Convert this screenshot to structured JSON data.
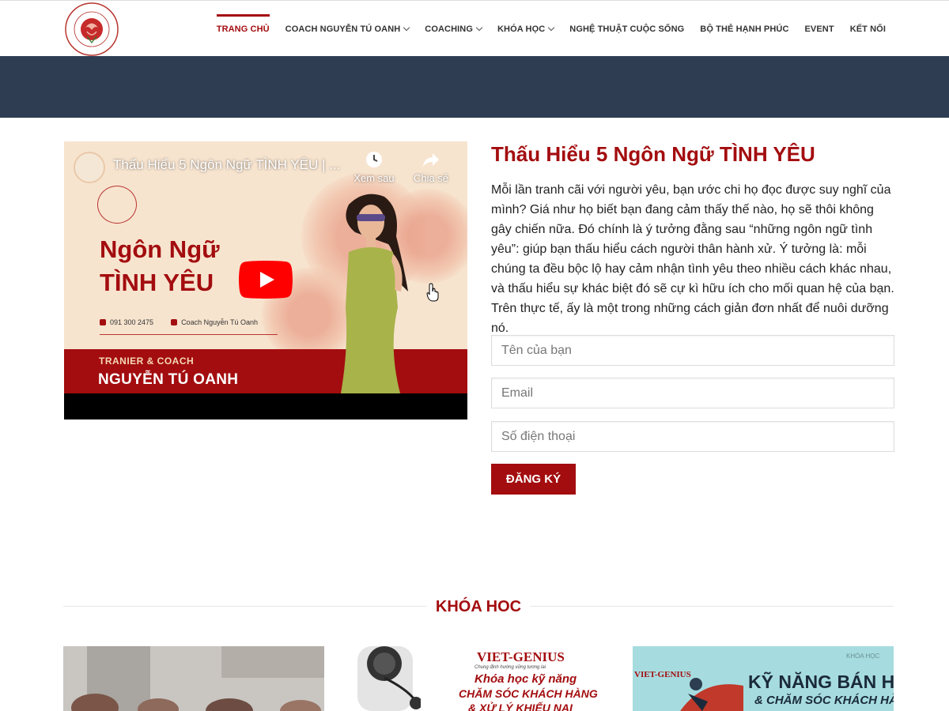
{
  "logo": {
    "alt": "COACH NGUYỄN TÚ OANH",
    "top_text": "COACH",
    "bottom_text": "NGUYỄN TÚ OANH"
  },
  "nav": {
    "items": [
      {
        "label": "TRANG CHỦ",
        "active": true,
        "has_dropdown": false
      },
      {
        "label": "COACH NGUYỄN TÚ OANH",
        "active": false,
        "has_dropdown": true
      },
      {
        "label": "COACHING",
        "active": false,
        "has_dropdown": true
      },
      {
        "label": "KHÓA HỌC",
        "active": false,
        "has_dropdown": true
      },
      {
        "label": "NGHỆ THUẬT CUỘC SỐNG",
        "active": false,
        "has_dropdown": false
      },
      {
        "label": "BỘ THẺ HẠNH PHÚC",
        "active": false,
        "has_dropdown": false
      },
      {
        "label": "EVENT",
        "active": false,
        "has_dropdown": false
      },
      {
        "label": "KẾT NỐI",
        "active": false,
        "has_dropdown": false
      }
    ]
  },
  "video": {
    "title": "Thấu Hiểu 5 Ngôn Ngữ TÌNH YÊU | ...",
    "watch_later": "Xem sau",
    "share": "Chia sẻ",
    "thumb_title_line1": "Ngôn Ngữ",
    "thumb_title_line2": "TÌNH YÊU",
    "phone": "091 300 2475",
    "facebook": "Coach Nguyễn Tú Oanh",
    "trainer_role": "TRANIER & COACH",
    "trainer_name": "NGUYỄN TÚ OANH"
  },
  "article": {
    "headline": "Thấu Hiểu 5 Ngôn Ngữ TÌNH YÊU",
    "body": "Mỗi lần tranh cãi với người yêu, bạn ước chi họ đọc được suy nghĩ của mình? Giá như họ biết bạn đang cảm thấy thế nào, họ sẽ thôi không gây chiến nữa. Đó chính là ý tưởng đằng sau “những ngôn ngữ tình yêu”: giúp bạn thấu hiểu cách người thân hành xử. Ý tưởng là: mỗi chúng ta đều bộc lộ hay cảm nhận tình yêu theo nhiều cách khác nhau, và thấu hiểu sự khác biệt đó sẽ cự kì hữu ích cho mối quan hệ của bạn. Trên thực tế, ấy là một trong những cách giản đơn nhất để nuôi dưỡng nó."
  },
  "form": {
    "name_placeholder": "Tên của bạn",
    "email_placeholder": "Email",
    "phone_placeholder": "Số điện thoại",
    "submit_label": "ĐĂNG KÝ"
  },
  "courses": {
    "section_title": "KHÓA HOC",
    "card2": {
      "brand": "VIET-GENIUS",
      "tagline": "Chung định hướng vững tương lai",
      "line1": "Khóa học kỹ năng",
      "line2": "CHĂM SÓC KHÁCH HÀNG",
      "line3": "& XỬ LÝ KHIẾU NẠI"
    },
    "card3": {
      "small": "KHÓA HỌC",
      "brand": "VIET-GENIUS",
      "line1": "KỸ NĂNG BÁN HÀNG",
      "line2": "& CHĂM SÓC KHÁCH HÀNG"
    }
  },
  "colors": {
    "brand_red": "#a30d0f",
    "banner_navy": "#2e3d52"
  }
}
